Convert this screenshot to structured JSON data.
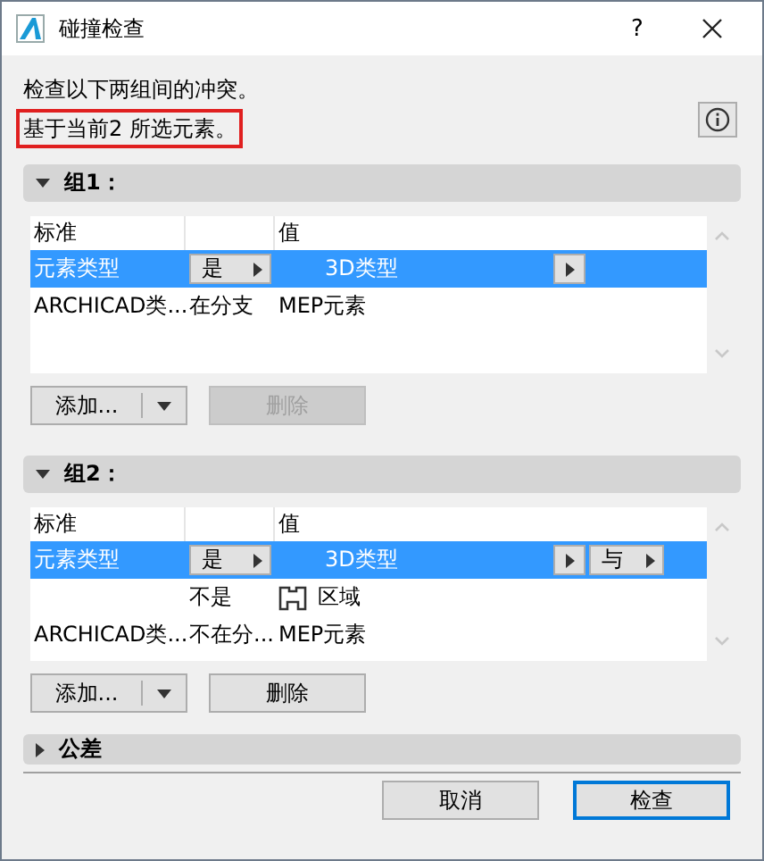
{
  "window": {
    "title": "碰撞检查",
    "help": "?"
  },
  "description": [
    {
      "text": "检查以下两组间的冲突。",
      "highlighted": false
    },
    {
      "text": "基于当前2 所选元素。",
      "highlighted": true
    }
  ],
  "groups": [
    {
      "title": "组1：",
      "expanded": true,
      "criterion_header": "标准",
      "value_header": "值",
      "rows": [
        {
          "criterion": "元素类型",
          "operator": "是",
          "value": "3D类型",
          "selected": true
        },
        {
          "criterion": "ARCHICAD类...",
          "operator": "在分支",
          "value": "MEP元素",
          "selected": false
        }
      ],
      "add_button": "添加...",
      "delete_button": {
        "label": "删除",
        "disabled": true
      }
    },
    {
      "title": "组2：",
      "expanded": true,
      "criterion_header": "标准",
      "value_header": "值",
      "rows": [
        {
          "criterion": "元素类型",
          "operator": "是",
          "value": "3D类型",
          "connector": "与",
          "selected": true
        },
        {
          "operator": "不是",
          "value": "区域",
          "value_icon": true,
          "selected": false
        },
        {
          "criterion": "ARCHICAD类...",
          "operator": "不在分...",
          "value": "MEP元素",
          "selected": false
        }
      ],
      "add_button": "添加...",
      "delete_button": {
        "label": "删除",
        "disabled": false
      }
    }
  ],
  "tolerance": {
    "title": "公差",
    "expanded": false
  },
  "buttons": [
    {
      "label": "取消",
      "default": false
    },
    {
      "label": "检查",
      "default": true
    }
  ]
}
